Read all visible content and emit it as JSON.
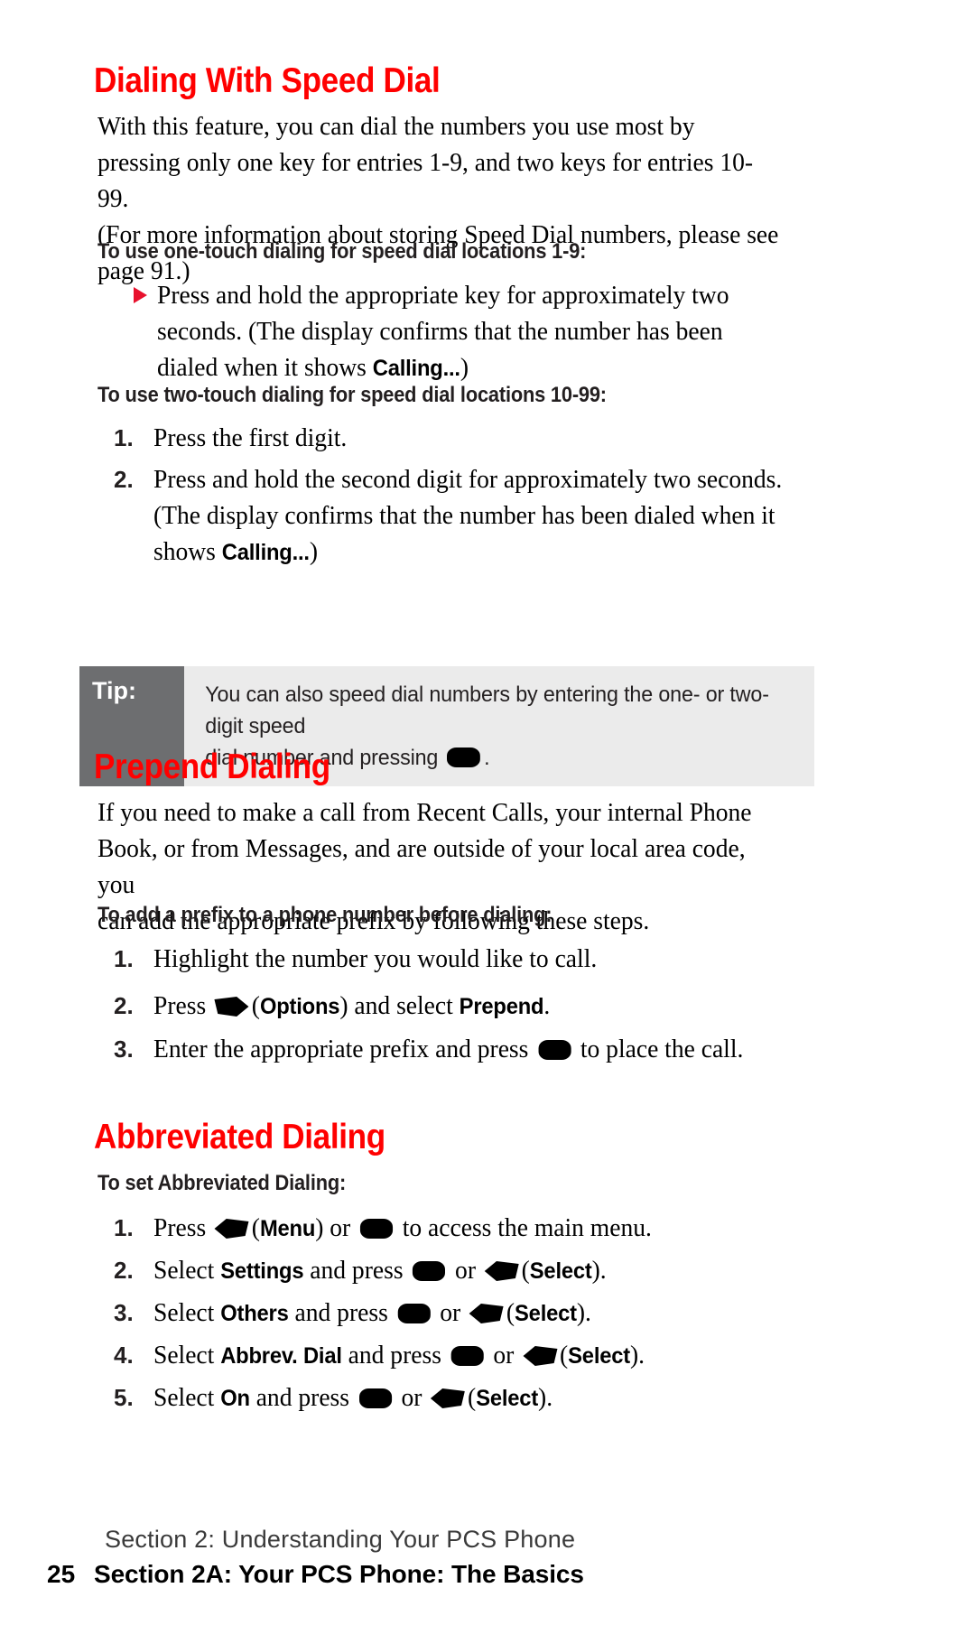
{
  "page": {
    "number": "25",
    "footer_top": "Section 2: Understanding Your PCS Phone",
    "footer_bottom": "Section 2A: Your PCS Phone: The Basics",
    "heading_color": "#ff0000",
    "bullet_color": "#e8112d",
    "tip_label_bg": "#6d6e70",
    "tip_body_bg": "#ebebeb"
  },
  "sections": {
    "speed_dial": {
      "heading": "Dialing With Speed Dial",
      "intro_1": "With this feature, you can dial the numbers you use most by",
      "intro_2": "pressing only one key for entries 1-9, and two keys for entries 10-99.",
      "intro_3": "(For more information about storing Speed Dial numbers, please see",
      "intro_4": "page 91.)",
      "sub_one_touch": "To use one-touch dialing for speed dial locations 1-9:",
      "one_touch_bullet_a": "Press and hold the appropriate key for approximately two",
      "one_touch_bullet_b": "seconds. (The display confirms that the number has been",
      "one_touch_bullet_c_pre": "dialed when it shows ",
      "one_touch_bullet_c_ui": "Calling...",
      "one_touch_bullet_c_post": ")",
      "sub_two_touch": "To use two-touch dialing for speed dial locations 10-99:",
      "steps": [
        {
          "num": "1.",
          "text": "Press the first digit."
        },
        {
          "num": "2.",
          "line_a": "Press and hold the second digit for approximately two seconds.",
          "line_b": "(The display confirms that the number has been dialed when it",
          "line_c_pre": "shows ",
          "line_c_ui": "Calling...",
          "line_c_post": ")"
        }
      ]
    },
    "tip": {
      "label": "Tip:",
      "line_1": "You can also speed dial numbers by entering the one- or two-digit speed",
      "line_2_pre": "dial number and pressing ",
      "line_2_icon": "ok-key-icon",
      "line_2_post": "."
    },
    "prepend": {
      "heading": "Prepend Dialing",
      "intro_1": "If you need to make a call from Recent Calls, your internal Phone",
      "intro_2": "Book, or from Messages, and are outside of your local area code, you",
      "intro_3": "can add the appropriate prefix by following these steps.",
      "sub": "To add a prefix to a phone number before dialing:",
      "steps": [
        {
          "num": "1.",
          "text": "Highlight the number you would like to call."
        },
        {
          "num": "2.",
          "pre": "Press ",
          "icon": "softkey-right-icon",
          "mid_open": "(",
          "ui": "Options",
          "mid_close": ") and select ",
          "ui2": "Prepend",
          "post": "."
        },
        {
          "num": "3.",
          "pre": "Enter the appropriate prefix and press ",
          "icon": "ok-key-icon",
          "post": " to place the call."
        }
      ]
    },
    "abbreviated": {
      "heading": "Abbreviated Dialing",
      "sub": "To set Abbreviated Dialing:",
      "steps": [
        {
          "num": "1.",
          "pre": "Press ",
          "icon_a": "softkey-left-icon",
          "ui_a": "Menu",
          "mid": " or ",
          "icon_b": "ok-key-icon",
          "post": " to access the main menu."
        },
        {
          "num": "2.",
          "pre": "Select ",
          "ui_item": "Settings",
          "mid_a": " and press ",
          "icon_a": "ok-key-icon",
          "mid_b": " or ",
          "icon_b": "softkey-left-icon",
          "ui_b": "Select",
          "post": "."
        },
        {
          "num": "3.",
          "pre": "Select ",
          "ui_item": "Others",
          "mid_a": " and press ",
          "icon_a": "ok-key-icon",
          "mid_b": " or ",
          "icon_b": "softkey-left-icon",
          "ui_b": "Select",
          "post": "."
        },
        {
          "num": "4.",
          "pre": "Select ",
          "ui_item": "Abbrev. Dial",
          "mid_a": " and press ",
          "icon_a": "ok-key-icon",
          "mid_b": " or ",
          "icon_b": "softkey-left-icon",
          "ui_b": "Select",
          "post": "."
        },
        {
          "num": "5.",
          "pre": "Select ",
          "ui_item": "On",
          "mid_a": " and press ",
          "icon_a": "ok-key-icon",
          "mid_b": " or ",
          "icon_b": "softkey-left-icon",
          "ui_b": "Select",
          "post": "."
        }
      ]
    }
  }
}
